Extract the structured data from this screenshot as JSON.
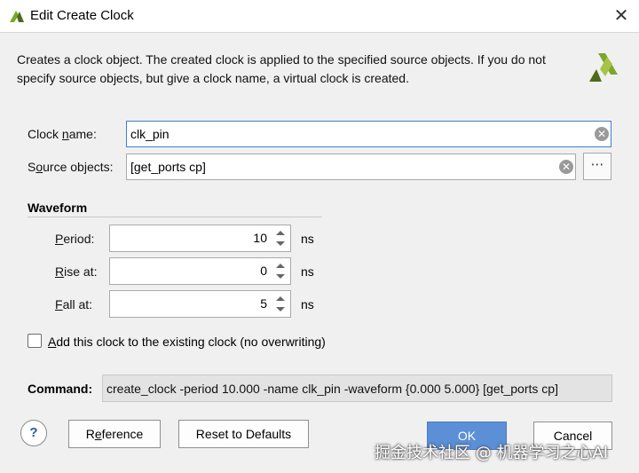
{
  "window": {
    "title": "Edit Create Clock"
  },
  "description": "Creates a clock object. The created clock is applied to the specified source objects. If you do not specify source objects, but give a clock name, a virtual clock is created.",
  "fields": {
    "clock_name": {
      "label_pre": "Clock ",
      "label_mn": "n",
      "label_post": "ame:",
      "value": "clk_pin"
    },
    "source_objects": {
      "label_pre": "S",
      "label_mn": "o",
      "label_post": "urce objects:",
      "value": "[get_ports cp]",
      "browse": "⋯"
    }
  },
  "waveform": {
    "title": "Waveform",
    "period": {
      "label_mn": "P",
      "label_post": "eriod:",
      "value": "10",
      "unit": "ns"
    },
    "rise": {
      "label_mn": "R",
      "label_post": "ise at:",
      "value": "0",
      "unit": "ns"
    },
    "fall": {
      "label_mn": "F",
      "label_post": "all at:",
      "value": "5",
      "unit": "ns"
    }
  },
  "no_overwrite": {
    "label_mn": "A",
    "label_post": "dd this clock to the existing clock (no overwriting)",
    "checked": false
  },
  "command": {
    "label": "Command:",
    "text": "create_clock -period 10.000 -name clk_pin -waveform {0.000 5.000} [get_ports cp]"
  },
  "buttons": {
    "help": "?",
    "reference_pre": "R",
    "reference_mn": "e",
    "reference_post": "ference",
    "defaults": "Reset to Defaults",
    "ok": "OK",
    "cancel": "Cancel"
  },
  "icons": {
    "clear": "✕",
    "close": "✕"
  },
  "watermark": "掘金技术社区 @ 机器学习之心AI",
  "colors": {
    "accent": "#5b8fd6",
    "logo_green": "#7ba82a",
    "logo_dark": "#4f6b1a"
  }
}
